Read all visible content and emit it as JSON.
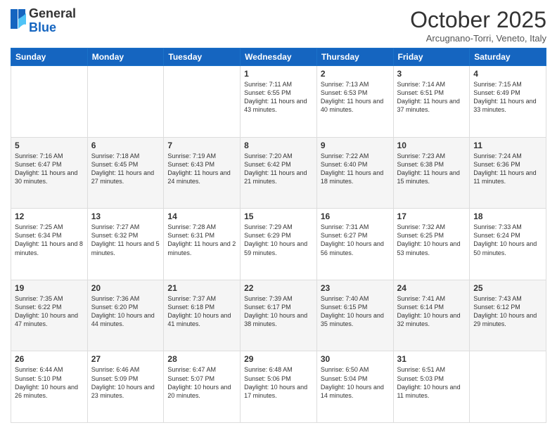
{
  "header": {
    "logo_general": "General",
    "logo_blue": "Blue",
    "month_title": "October 2025",
    "subtitle": "Arcugnano-Torri, Veneto, Italy"
  },
  "days_of_week": [
    "Sunday",
    "Monday",
    "Tuesday",
    "Wednesday",
    "Thursday",
    "Friday",
    "Saturday"
  ],
  "weeks": [
    [
      {
        "day": "",
        "info": ""
      },
      {
        "day": "",
        "info": ""
      },
      {
        "day": "",
        "info": ""
      },
      {
        "day": "1",
        "info": "Sunrise: 7:11 AM\nSunset: 6:55 PM\nDaylight: 11 hours and 43 minutes."
      },
      {
        "day": "2",
        "info": "Sunrise: 7:13 AM\nSunset: 6:53 PM\nDaylight: 11 hours and 40 minutes."
      },
      {
        "day": "3",
        "info": "Sunrise: 7:14 AM\nSunset: 6:51 PM\nDaylight: 11 hours and 37 minutes."
      },
      {
        "day": "4",
        "info": "Sunrise: 7:15 AM\nSunset: 6:49 PM\nDaylight: 11 hours and 33 minutes."
      }
    ],
    [
      {
        "day": "5",
        "info": "Sunrise: 7:16 AM\nSunset: 6:47 PM\nDaylight: 11 hours and 30 minutes."
      },
      {
        "day": "6",
        "info": "Sunrise: 7:18 AM\nSunset: 6:45 PM\nDaylight: 11 hours and 27 minutes."
      },
      {
        "day": "7",
        "info": "Sunrise: 7:19 AM\nSunset: 6:43 PM\nDaylight: 11 hours and 24 minutes."
      },
      {
        "day": "8",
        "info": "Sunrise: 7:20 AM\nSunset: 6:42 PM\nDaylight: 11 hours and 21 minutes."
      },
      {
        "day": "9",
        "info": "Sunrise: 7:22 AM\nSunset: 6:40 PM\nDaylight: 11 hours and 18 minutes."
      },
      {
        "day": "10",
        "info": "Sunrise: 7:23 AM\nSunset: 6:38 PM\nDaylight: 11 hours and 15 minutes."
      },
      {
        "day": "11",
        "info": "Sunrise: 7:24 AM\nSunset: 6:36 PM\nDaylight: 11 hours and 11 minutes."
      }
    ],
    [
      {
        "day": "12",
        "info": "Sunrise: 7:25 AM\nSunset: 6:34 PM\nDaylight: 11 hours and 8 minutes."
      },
      {
        "day": "13",
        "info": "Sunrise: 7:27 AM\nSunset: 6:32 PM\nDaylight: 11 hours and 5 minutes."
      },
      {
        "day": "14",
        "info": "Sunrise: 7:28 AM\nSunset: 6:31 PM\nDaylight: 11 hours and 2 minutes."
      },
      {
        "day": "15",
        "info": "Sunrise: 7:29 AM\nSunset: 6:29 PM\nDaylight: 10 hours and 59 minutes."
      },
      {
        "day": "16",
        "info": "Sunrise: 7:31 AM\nSunset: 6:27 PM\nDaylight: 10 hours and 56 minutes."
      },
      {
        "day": "17",
        "info": "Sunrise: 7:32 AM\nSunset: 6:25 PM\nDaylight: 10 hours and 53 minutes."
      },
      {
        "day": "18",
        "info": "Sunrise: 7:33 AM\nSunset: 6:24 PM\nDaylight: 10 hours and 50 minutes."
      }
    ],
    [
      {
        "day": "19",
        "info": "Sunrise: 7:35 AM\nSunset: 6:22 PM\nDaylight: 10 hours and 47 minutes."
      },
      {
        "day": "20",
        "info": "Sunrise: 7:36 AM\nSunset: 6:20 PM\nDaylight: 10 hours and 44 minutes."
      },
      {
        "day": "21",
        "info": "Sunrise: 7:37 AM\nSunset: 6:18 PM\nDaylight: 10 hours and 41 minutes."
      },
      {
        "day": "22",
        "info": "Sunrise: 7:39 AM\nSunset: 6:17 PM\nDaylight: 10 hours and 38 minutes."
      },
      {
        "day": "23",
        "info": "Sunrise: 7:40 AM\nSunset: 6:15 PM\nDaylight: 10 hours and 35 minutes."
      },
      {
        "day": "24",
        "info": "Sunrise: 7:41 AM\nSunset: 6:14 PM\nDaylight: 10 hours and 32 minutes."
      },
      {
        "day": "25",
        "info": "Sunrise: 7:43 AM\nSunset: 6:12 PM\nDaylight: 10 hours and 29 minutes."
      }
    ],
    [
      {
        "day": "26",
        "info": "Sunrise: 6:44 AM\nSunset: 5:10 PM\nDaylight: 10 hours and 26 minutes."
      },
      {
        "day": "27",
        "info": "Sunrise: 6:46 AM\nSunset: 5:09 PM\nDaylight: 10 hours and 23 minutes."
      },
      {
        "day": "28",
        "info": "Sunrise: 6:47 AM\nSunset: 5:07 PM\nDaylight: 10 hours and 20 minutes."
      },
      {
        "day": "29",
        "info": "Sunrise: 6:48 AM\nSunset: 5:06 PM\nDaylight: 10 hours and 17 minutes."
      },
      {
        "day": "30",
        "info": "Sunrise: 6:50 AM\nSunset: 5:04 PM\nDaylight: 10 hours and 14 minutes."
      },
      {
        "day": "31",
        "info": "Sunrise: 6:51 AM\nSunset: 5:03 PM\nDaylight: 10 hours and 11 minutes."
      },
      {
        "day": "",
        "info": ""
      }
    ]
  ]
}
